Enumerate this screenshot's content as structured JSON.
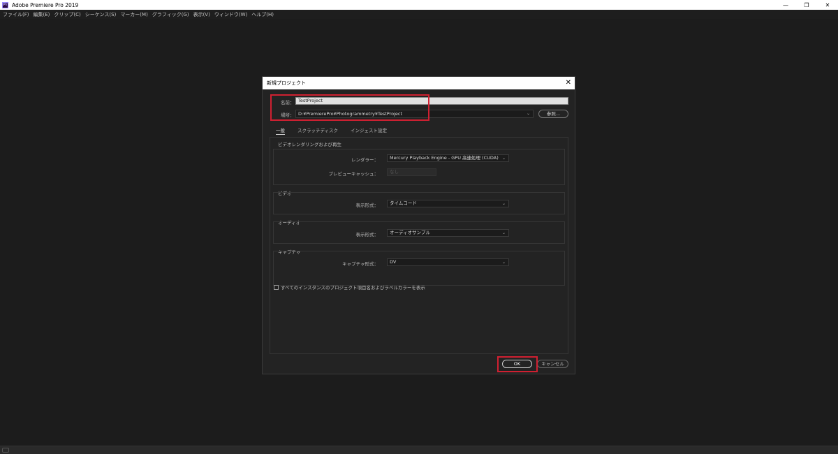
{
  "window": {
    "app_icon": "Pr",
    "title": "Adobe Premiere Pro 2019",
    "minimize": "—",
    "restore": "❐",
    "close": "✕"
  },
  "menu": [
    "ファイル(F)",
    "編集(E)",
    "クリップ(C)",
    "シーケンス(S)",
    "マーカー(M)",
    "グラフィック(G)",
    "表示(V)",
    "ウィンドウ(W)",
    "ヘルプ(H)"
  ],
  "dialog": {
    "title": "新規プロジェクト",
    "close": "✕",
    "name_label": "名前：",
    "name_value": "TestProject",
    "location_label": "場所：",
    "location_value": "D:¥PremierePro¥Photogrammetry¥TestProject",
    "browse_label": "参照...",
    "tabs": [
      "一般",
      "スクラッチディスク",
      "インジェスト設定"
    ],
    "sections": {
      "render": {
        "title": "ビデオレンダリングおよび再生",
        "renderer_label": "レンダラー：",
        "renderer_value": "Mercury Playback Engine - GPU 高速処理 (CUDA)",
        "preview_cache_label": "プレビューキャッシュ：",
        "preview_cache_value": "なし"
      },
      "video": {
        "title": "ビデオ",
        "display_format_label": "表示形式：",
        "display_format_value": "タイムコード"
      },
      "audio": {
        "title": "オーディオ",
        "display_format_label": "表示形式：",
        "display_format_value": "オーディオサンプル"
      },
      "capture": {
        "title": "キャプチャ",
        "capture_format_label": "キャプチャ形式：",
        "capture_format_value": "DV"
      }
    },
    "checkbox_label": "すべてのインスタンスのプロジェクト項目名およびラベルカラーを表示",
    "checkbox_checked": false,
    "ok_label": "OK",
    "cancel_label": "キャンセル"
  },
  "colors": {
    "highlight": "#d02031",
    "background": "#1c1c1c",
    "dialog_bg": "#232323"
  }
}
